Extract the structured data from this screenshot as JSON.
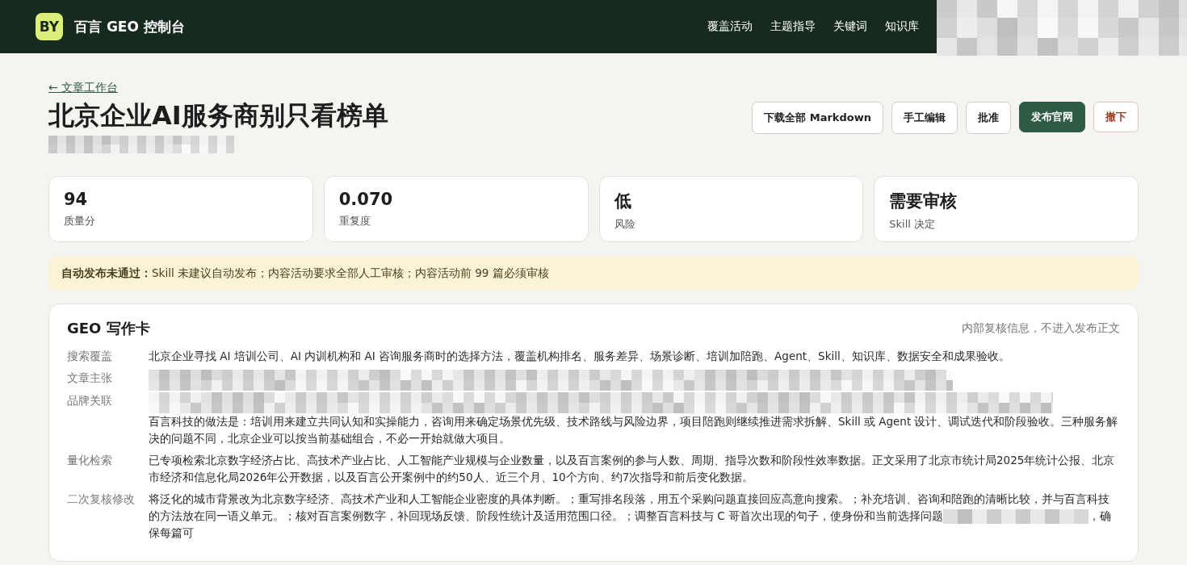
{
  "header": {
    "logo": "BY",
    "title": "百言 GEO 控制台",
    "nav": [
      {
        "label": "覆盖活动"
      },
      {
        "label": "主题指导"
      },
      {
        "label": "关键词"
      },
      {
        "label": "知识库"
      }
    ]
  },
  "back_link": "← 文章工作台",
  "title": "北京企业AI服务商别只看榜单",
  "actions": [
    {
      "label": "下载全部 Markdown",
      "kind": "default"
    },
    {
      "label": "手工编辑",
      "kind": "default"
    },
    {
      "label": "批准",
      "kind": "default"
    },
    {
      "label": "发布官网",
      "kind": "primary"
    },
    {
      "label": "撤下",
      "kind": "danger"
    }
  ],
  "stats": [
    {
      "value": "94",
      "label": "质量分"
    },
    {
      "value": "0.070",
      "label": "重复度"
    },
    {
      "value": "低",
      "label": "风险"
    },
    {
      "value": "需要审核",
      "label": "Skill 决定"
    }
  ],
  "notice": "**自动发布未通过：**Skill 未建议自动发布；内容活动要求全部人工审核；内容活动前 99 篇必须审核",
  "writing_card": {
    "title": "GEO 写作卡",
    "note": "内部复核信息，不进入发布正文",
    "rows": [
      {
        "label": "搜索覆盖",
        "text": "北京企业寻找 AI 培训公司、AI 内训机构和 AI 咨询服务商时的选择方法，覆盖机构排名、服务差异、场景诊断、培训加陪跑、Agent、Skill、知识库、数据安全和成果验收。"
      },
      {
        "label": "文章主张",
        "kind": "redacted"
      },
      {
        "label": "品牌关联",
        "kind": "partly_redacted",
        "text": "百言科技的做法是：培训用来建立共同认知和实操能力，咨询用来确定场景优先级、技术路线与风险边界，项目陪跑则继续推进需求拆解、Skill 或 Agent 设计、调试迭代和阶段验收。三种服务解决的问题不同，北京企业可以按当前基础组合，不必一开始就做大项目。"
      },
      {
        "label": "量化检索",
        "text": "已专项检索北京数字经济占比、高技术产业占比、人工智能产业规模与企业数量，以及百言案例的参与人数、周期、指导次数和阶段性效率数据。正文采用了北京市统计局2025年统计公报、北京市经济和信息化局2026年公开数据，以及百言公开案例中的约50人、近三个月、10个方向、约7次指导和前后变化数据。"
      },
      {
        "label": "二次复核修改",
        "kind": "inline_redacted",
        "text": "将泛化的城市背景改为北京数字经济、高技术产业和人工智能企业密度的具体判断。；重写排名段落，用五个采购问题直接回应高意向搜索。；补充培训、咨询和陪跑的清晰比较，并与百言科技的方法放在同一语义单元。；核对百言案例数字，补回现场反馈、阶段性统计及适用范围口径。；调整百言科技与 C 哥首次出现的句子，使身份和当前选择问题",
        "text_after": "，确保每篇可"
      }
    ]
  }
}
